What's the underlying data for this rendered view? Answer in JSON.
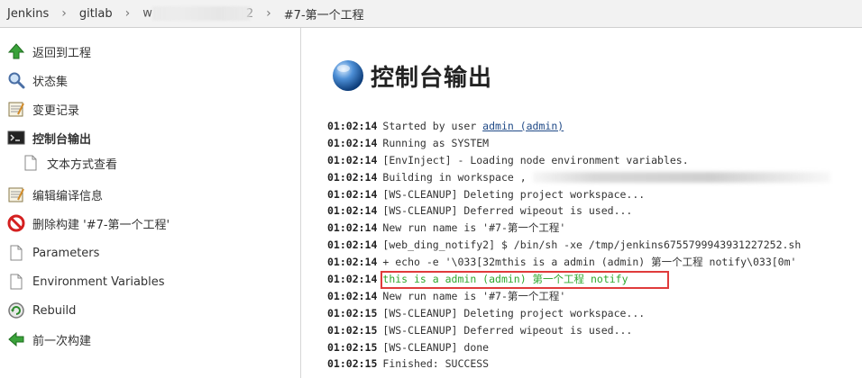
{
  "breadcrumb": {
    "jenkins": "Jenkins",
    "gitlab": "gitlab",
    "job_partial_start": "w",
    "job_partial_end": "2",
    "build": "#7-第一个工程",
    "separator": "›"
  },
  "sidebar": {
    "items": [
      {
        "label": "返回到工程",
        "icon": "up-arrow-icon"
      },
      {
        "label": "状态集",
        "icon": "magnifier-icon"
      },
      {
        "label": "变更记录",
        "icon": "notepad-icon"
      },
      {
        "label": "控制台输出",
        "icon": "terminal-icon"
      },
      {
        "label": "文本方式查看",
        "icon": "document-icon"
      },
      {
        "label": "编辑编译信息",
        "icon": "notepad-icon"
      },
      {
        "label": "删除构建 '#7-第一个工程'",
        "icon": "no-entry-icon"
      },
      {
        "label": "Parameters",
        "icon": "document-icon"
      },
      {
        "label": "Environment Variables",
        "icon": "document-icon"
      },
      {
        "label": "Rebuild",
        "icon": "rebuild-icon"
      },
      {
        "label": "前一次构建",
        "icon": "left-arrow-icon"
      }
    ]
  },
  "main": {
    "title": "控制台输出",
    "console": [
      {
        "ts": "01:02:14",
        "text": "Started by user ",
        "link": "admin (admin)"
      },
      {
        "ts": "01:02:14",
        "text": "Running as SYSTEM"
      },
      {
        "ts": "01:02:14",
        "text": "[EnvInject] - Loading node environment variables."
      },
      {
        "ts": "01:02:14",
        "text": "Building in workspace ,"
      },
      {
        "ts": "01:02:14",
        "text": "[WS-CLEANUP] Deleting project workspace..."
      },
      {
        "ts": "01:02:14",
        "text": "[WS-CLEANUP] Deferred wipeout is used..."
      },
      {
        "ts": "01:02:14",
        "text": "New run name is '#7-第一个工程'"
      },
      {
        "ts": "01:02:14",
        "text": "[web_ding_notify2] $ /bin/sh -xe /tmp/jenkins6755799943931227252.sh"
      },
      {
        "ts": "01:02:14",
        "text": "+ echo -e '\\033[32mthis is a admin (admin) 第一个工程 notify\\033[0m'"
      },
      {
        "ts": "01:02:14",
        "text": "this is a admin (admin) 第一个工程 notify"
      },
      {
        "ts": "01:02:14",
        "text": "New run name is '#7-第一个工程'"
      },
      {
        "ts": "01:02:15",
        "text": "[WS-CLEANUP] Deleting project workspace..."
      },
      {
        "ts": "01:02:15",
        "text": "[WS-CLEANUP] Deferred wipeout is used..."
      },
      {
        "ts": "01:02:15",
        "text": "[WS-CLEANUP] done"
      },
      {
        "ts": "01:02:15",
        "text": "Finished: SUCCESS"
      }
    ]
  },
  "colors": {
    "highlight_border": "#e03b3b",
    "green_output": "#2fa82f",
    "link": "#204a87"
  }
}
